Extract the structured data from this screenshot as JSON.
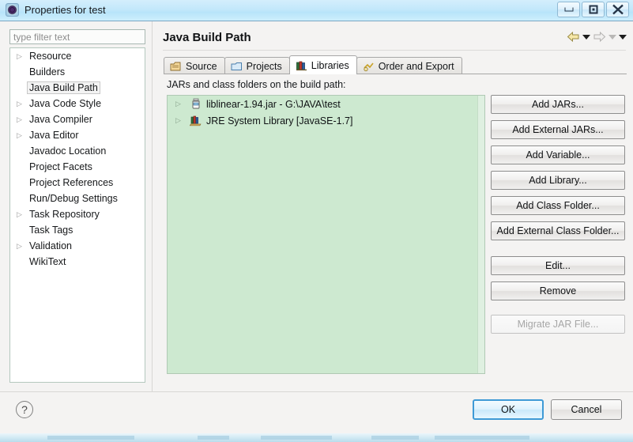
{
  "window": {
    "title": "Properties for test",
    "icon": "properties-gear-icon",
    "controls": [
      {
        "name": "minimize-button",
        "glyph": "minimize"
      },
      {
        "name": "maximize-button",
        "glyph": "maximize"
      },
      {
        "name": "close-button",
        "glyph": "close"
      }
    ]
  },
  "sidebar": {
    "filter": {
      "value": "",
      "placeholder": "type filter text"
    },
    "items": [
      {
        "label": "Resource",
        "expandable": true,
        "selected": false
      },
      {
        "label": "Builders",
        "expandable": false,
        "selected": false
      },
      {
        "label": "Java Build Path",
        "expandable": false,
        "selected": true
      },
      {
        "label": "Java Code Style",
        "expandable": true,
        "selected": false
      },
      {
        "label": "Java Compiler",
        "expandable": true,
        "selected": false
      },
      {
        "label": "Java Editor",
        "expandable": true,
        "selected": false
      },
      {
        "label": "Javadoc Location",
        "expandable": false,
        "selected": false
      },
      {
        "label": "Project Facets",
        "expandable": false,
        "selected": false
      },
      {
        "label": "Project References",
        "expandable": false,
        "selected": false
      },
      {
        "label": "Run/Debug Settings",
        "expandable": false,
        "selected": false
      },
      {
        "label": "Task Repository",
        "expandable": true,
        "selected": false
      },
      {
        "label": "Task Tags",
        "expandable": false,
        "selected": false
      },
      {
        "label": "Validation",
        "expandable": true,
        "selected": false
      },
      {
        "label": "WikiText",
        "expandable": false,
        "selected": false
      }
    ]
  },
  "page": {
    "title": "Java Build Path",
    "nav": {
      "back_icon": "back-arrow-icon",
      "back_dropdown_icon": "chevron-down-icon",
      "forward_icon": "forward-arrow-icon",
      "forward_dropdown_icon": "chevron-down-icon",
      "menu_icon": "chevron-down-icon"
    },
    "tabs": [
      {
        "label": "Source",
        "icon": "source-folder-icon",
        "active": false
      },
      {
        "label": "Projects",
        "icon": "projects-folder-icon",
        "active": false
      },
      {
        "label": "Libraries",
        "icon": "libraries-books-icon",
        "active": true
      },
      {
        "label": "Order and Export",
        "icon": "order-export-icon",
        "active": false
      }
    ],
    "libraries": {
      "description": "JARs and class folders on the build path:",
      "entries": [
        {
          "label": "liblinear-1.94.jar - G:\\JAVA\\test",
          "icon": "jar-file-icon",
          "expandable": true
        },
        {
          "label": "JRE System Library [JavaSE-1.7]",
          "icon": "jre-library-icon",
          "expandable": true
        }
      ],
      "buttons": [
        {
          "label": "Add JARs...",
          "name": "add-jars-button",
          "enabled": true,
          "group": 1
        },
        {
          "label": "Add External JARs...",
          "name": "add-external-jars-button",
          "enabled": true,
          "group": 1
        },
        {
          "label": "Add Variable...",
          "name": "add-variable-button",
          "enabled": true,
          "group": 1
        },
        {
          "label": "Add Library...",
          "name": "add-library-button",
          "enabled": true,
          "group": 1
        },
        {
          "label": "Add Class Folder...",
          "name": "add-class-folder-button",
          "enabled": true,
          "group": 1
        },
        {
          "label": "Add External Class Folder...",
          "name": "add-external-class-folder-button",
          "enabled": true,
          "group": 1
        },
        {
          "label": "Edit...",
          "name": "edit-button",
          "enabled": true,
          "group": 2
        },
        {
          "label": "Remove",
          "name": "remove-button",
          "enabled": true,
          "group": 2
        },
        {
          "label": "Migrate JAR File...",
          "name": "migrate-jar-file-button",
          "enabled": false,
          "group": 3
        }
      ]
    }
  },
  "footer": {
    "help_icon": "help-question-icon",
    "ok_label": "OK",
    "cancel_label": "Cancel"
  },
  "colors": {
    "titlebar_accent": "#bfe6fa",
    "tree_background": "#cde9d0",
    "default_button_border": "#3f9ad6"
  }
}
